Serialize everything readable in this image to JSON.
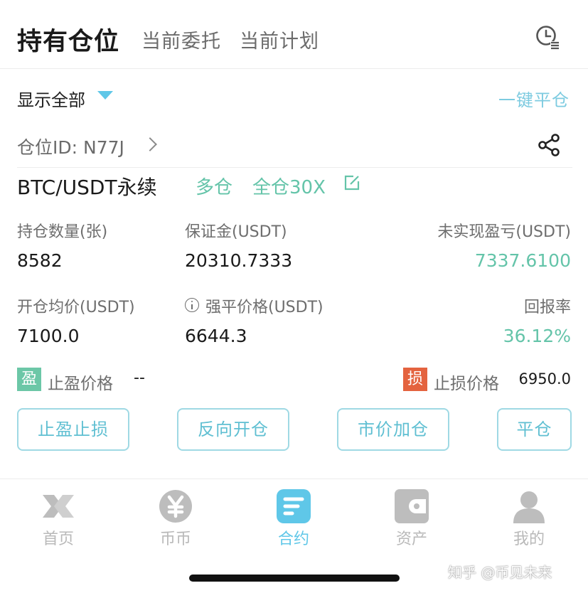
{
  "tabs": {
    "active": "持有仓位",
    "items": [
      "当前委托",
      "当前计划"
    ]
  },
  "filter": {
    "label": "显示全部",
    "close_all": "一键平仓"
  },
  "position": {
    "id_label": "仓位ID: N77J",
    "contract": "BTC/USDT永续",
    "side": "多仓",
    "margin_mode": "全仓30X"
  },
  "stats": {
    "qty_label": "持仓数量(张)",
    "qty_value": "8582",
    "margin_label": "保证金(USDT)",
    "margin_value": "20310.7333",
    "upnl_label": "未实现盈亏(USDT)",
    "upnl_value": "7337.6100",
    "entry_label": "开仓均价(USDT)",
    "entry_value": "7100.0",
    "liq_label": "强平价格(USDT)",
    "liq_value": "6644.3",
    "roe_label": "回报率",
    "roe_value": "36.12%"
  },
  "tpsl": {
    "tp_badge": "盈",
    "tp_label": "止盈价格",
    "tp_value": "--",
    "sl_badge": "损",
    "sl_label": "止损价格",
    "sl_value": "6950.0"
  },
  "actions": [
    "止盈止损",
    "反向开仓",
    "市价加仓",
    "平仓"
  ],
  "nav": [
    {
      "label": "首页",
      "icon": "logo-x-icon"
    },
    {
      "label": "币币",
      "icon": "yen-coin-icon"
    },
    {
      "label": "合约",
      "icon": "contract-icon",
      "active": true
    },
    {
      "label": "资产",
      "icon": "wallet-icon"
    },
    {
      "label": "我的",
      "icon": "user-icon"
    }
  ],
  "watermark": "知乎 @币见未来",
  "colors": {
    "accent": "#5fc7e8",
    "profit": "#64c4a9",
    "loss": "#e4633f",
    "button_border": "#9fd9e4"
  }
}
